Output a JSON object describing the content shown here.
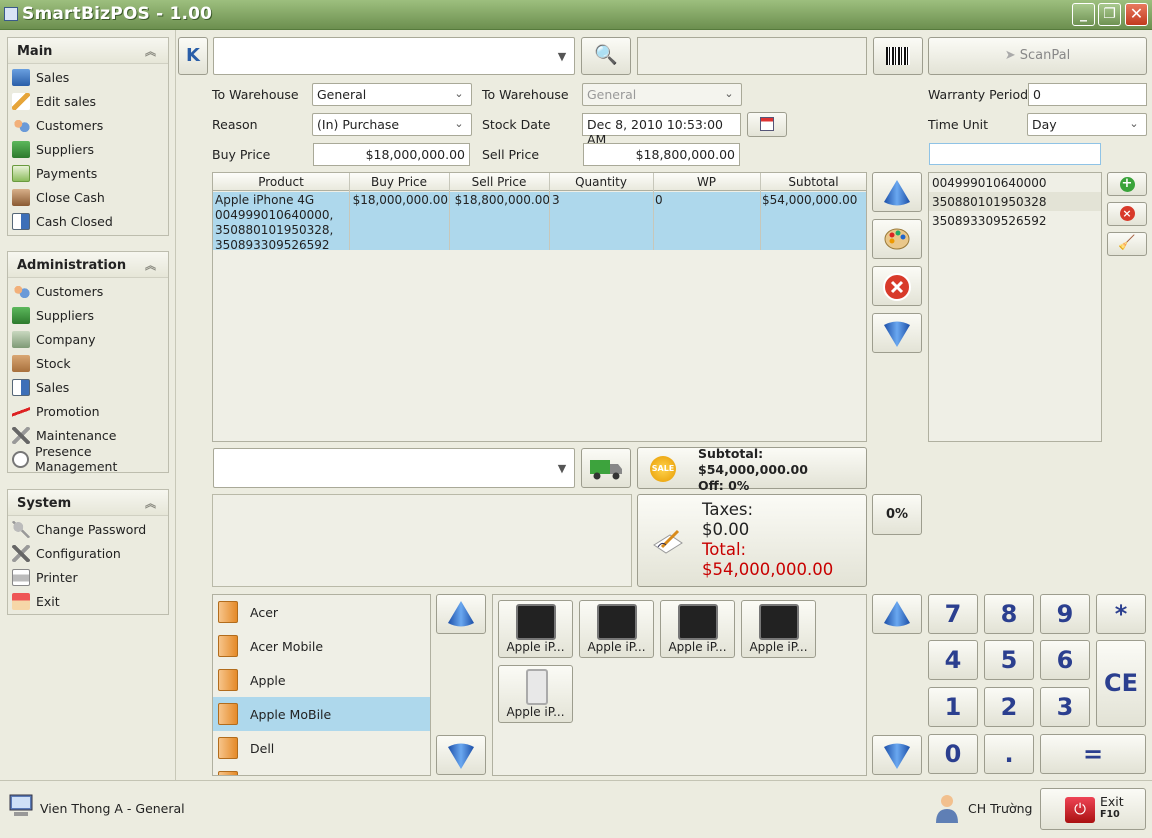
{
  "window": {
    "title": "SmartBizPOS - 1.00"
  },
  "sidebar": {
    "main": {
      "title": "Main",
      "items": [
        {
          "label": "Sales",
          "icon": "sales-icon"
        },
        {
          "label": "Edit sales",
          "icon": "edit-icon"
        },
        {
          "label": "Customers",
          "icon": "customers-icon"
        },
        {
          "label": "Suppliers",
          "icon": "truck-icon"
        },
        {
          "label": "Payments",
          "icon": "payments-icon"
        },
        {
          "label": "Close Cash",
          "icon": "safe-icon"
        },
        {
          "label": "Cash Closed",
          "icon": "report-icon"
        }
      ]
    },
    "administration": {
      "title": "Administration",
      "items": [
        {
          "label": "Customers",
          "icon": "customers-icon"
        },
        {
          "label": "Suppliers",
          "icon": "truck-icon"
        },
        {
          "label": "Company",
          "icon": "building-icon"
        },
        {
          "label": "Stock",
          "icon": "box-icon"
        },
        {
          "label": "Sales",
          "icon": "report-icon"
        },
        {
          "label": "Promotion",
          "icon": "chart-icon"
        },
        {
          "label": "Maintenance",
          "icon": "tools-icon"
        },
        {
          "label": "Presence Management",
          "icon": "clock-icon"
        }
      ]
    },
    "system": {
      "title": "System",
      "items": [
        {
          "label": "Change Password",
          "icon": "key-icon"
        },
        {
          "label": "Configuration",
          "icon": "tools-icon"
        },
        {
          "label": "Printer",
          "icon": "printer-icon"
        },
        {
          "label": "Exit",
          "icon": "home-icon"
        }
      ]
    }
  },
  "toolbar": {
    "search_value": "",
    "barcode_field": "",
    "scanpal_label": "ScanPal"
  },
  "form": {
    "to_warehouse_label": "To Warehouse",
    "to_warehouse_value": "General",
    "to_warehouse2_label": "To Warehouse",
    "to_warehouse2_value": "General",
    "reason_label": "Reason",
    "reason_value": "(In) Purchase",
    "stock_date_label": "Stock Date",
    "stock_date_value": "Dec 8, 2010 10:53:00 AM",
    "buy_price_label": "Buy Price",
    "buy_price_value": "$18,000,000.00",
    "sell_price_label": "Sell Price",
    "sell_price_value": "$18,800,000.00",
    "warranty_label": "Warranty Period",
    "warranty_value": "0",
    "time_unit_label": "Time Unit",
    "time_unit_value": "Day",
    "serial_input": ""
  },
  "table": {
    "columns": [
      "Product",
      "Buy Price",
      "Sell Price",
      "Quantity",
      "WP",
      "Subtotal"
    ],
    "rows": [
      {
        "product_lines": [
          "Apple iPhone 4G",
          "004999010640000,",
          "350880101950328,",
          "350893309526592"
        ],
        "buy_price": "$18,000,000.00",
        "sell_price": "$18,800,000.00",
        "quantity": "3",
        "wp": "0",
        "subtotal": "$54,000,000.00"
      }
    ]
  },
  "serials": [
    "004999010640000",
    "350880101950328",
    "350893309526592"
  ],
  "summary": {
    "subtotal_label": "Subtotal:",
    "subtotal_value": "$54,000,000.00",
    "off_label": "Off: 0%",
    "taxes_label": "Taxes:",
    "taxes_value": "$0.00",
    "total_label": "Total:",
    "total_value": "$54,000,000.00",
    "discount_button": "0%",
    "sale_badge": "SALE"
  },
  "categories": [
    "Acer",
    "Acer Mobile",
    "Apple",
    "Apple MoBile",
    "Dell"
  ],
  "products": [
    "Apple iP...",
    "Apple iP...",
    "Apple iP...",
    "Apple iP...",
    "Apple iP..."
  ],
  "keypad": {
    "k7": "7",
    "k8": "8",
    "k9": "9",
    "kmul": "*",
    "k4": "4",
    "k5": "5",
    "k6": "6",
    "kce": "CE",
    "k1": "1",
    "k2": "2",
    "k3": "3",
    "k0": "0",
    "kdot": ".",
    "keq": "="
  },
  "status": {
    "location": "Vien Thong A - General",
    "user": "CH Trường",
    "exit_label": "Exit",
    "exit_key": "F10"
  },
  "colors": {
    "selection": "#aed8ec",
    "total": "#c80000",
    "keypad_text": "#2b3f8f",
    "titlebar": "#7fa160"
  }
}
